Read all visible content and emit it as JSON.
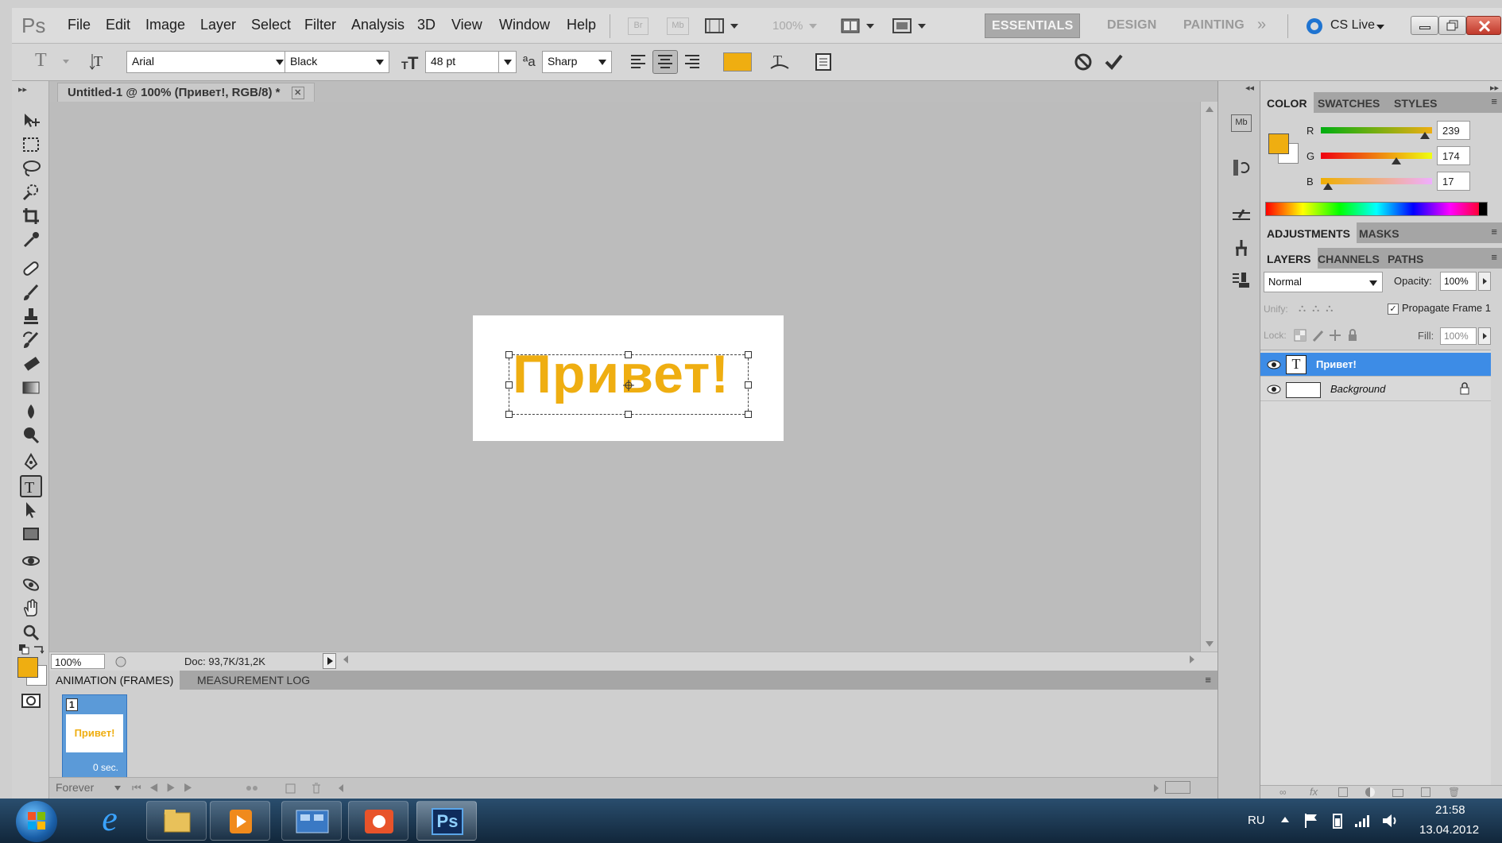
{
  "app": {
    "logo": "Ps"
  },
  "menu": [
    "File",
    "Edit",
    "Image",
    "Layer",
    "Select",
    "Filter",
    "Analysis",
    "3D",
    "View",
    "Window",
    "Help"
  ],
  "header": {
    "bridge_label": "Br",
    "minibridge_label": "Mb",
    "zoom_value": "100%",
    "workspaces": [
      "ESSENTIALS",
      "DESIGN",
      "PAINTING"
    ],
    "more_workspaces": "»",
    "cs_live": "CS Live"
  },
  "options": {
    "tool_glyph": "T",
    "font_family": "Arial",
    "font_style": "Black",
    "font_size": "48 pt",
    "antialias_label": "ªa",
    "antialias": "Sharp",
    "text_color": "#efae11"
  },
  "document": {
    "tab_title": "Untitled-1 @ 100% (Привет!, RGB/8) *",
    "close_glyph": "✕",
    "headline": "Привет!",
    "zoom": "100%",
    "doc_info": "Doc: 93,7K/31,2K"
  },
  "animation": {
    "tabs": [
      "ANIMATION (FRAMES)",
      "MEASUREMENT LOG"
    ],
    "frame_number": "1",
    "frame_thumb_text": "Привет!",
    "frame_delay": "0 sec.",
    "loop": "Forever"
  },
  "color_panel": {
    "tabs": [
      "COLOR",
      "SWATCHES",
      "STYLES"
    ],
    "foreground": "#efae11",
    "background": "#ffffff",
    "channels": [
      {
        "name": "R",
        "value": "239",
        "level": 0.937
      },
      {
        "name": "G",
        "value": "174",
        "level": 0.682
      },
      {
        "name": "B",
        "value": "17",
        "level": 0.067
      }
    ]
  },
  "adjustments_panel": {
    "tabs": [
      "ADJUSTMENTS",
      "MASKS"
    ]
  },
  "layers_panel": {
    "tabs": [
      "LAYERS",
      "CHANNELS",
      "PATHS"
    ],
    "blend_mode": "Normal",
    "opacity_label": "Opacity:",
    "opacity": "100%",
    "unify_label": "Unify:",
    "propagate_label": "Propagate Frame 1",
    "lock_label": "Lock:",
    "fill_label": "Fill:",
    "fill": "100%",
    "layers": [
      {
        "name": "Привет!",
        "type_glyph": "T",
        "selected": true
      },
      {
        "name": "Background",
        "selected": false
      }
    ]
  },
  "taskbar": {
    "lang": "RU",
    "time": "21:58",
    "date": "13.04.2012",
    "ie_glyph": "e",
    "ps_label": "Ps"
  },
  "colors": {
    "accent": "#efae11",
    "selection": "#3b8ee8",
    "layer_selected": "#3d8ce6"
  }
}
